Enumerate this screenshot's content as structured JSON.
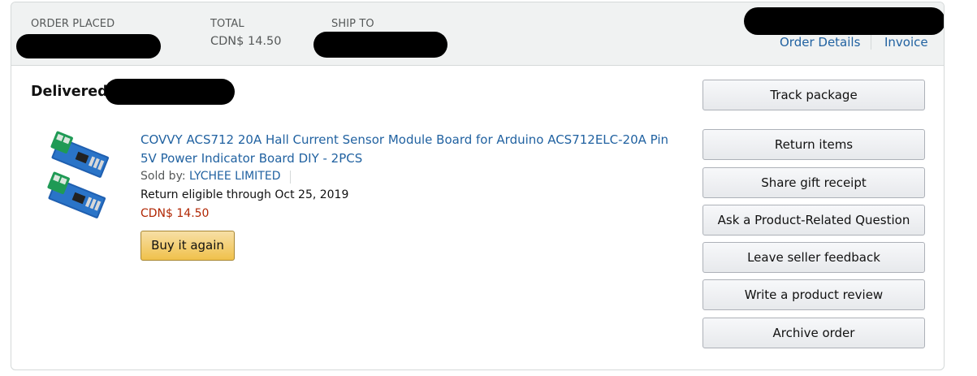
{
  "header": {
    "order_placed_label": "ORDER PLACED",
    "total_label": "TOTAL",
    "total_value": "CDN$ 14.50",
    "ship_to_label": "SHIP TO",
    "order_details_link": "Order Details",
    "invoice_link": "Invoice"
  },
  "status": {
    "title": "Delivered"
  },
  "item": {
    "title": "COVVY ACS712 20A Hall Current Sensor Module Board for Arduino ACS712ELC-20A Pin 5V Power Indicator Board DIY - 2PCS",
    "sold_by_label": "Sold by: ",
    "seller": "LYCHEE LIMITED",
    "return_eligible": "Return eligible through Oct 25, 2019",
    "price": "CDN$ 14.50",
    "buy_again_label": "Buy it again"
  },
  "actions": {
    "track_package": "Track package",
    "return_items": "Return items",
    "share_gift_receipt": "Share gift receipt",
    "ask_question": "Ask a Product-Related Question",
    "leave_feedback": "Leave seller feedback",
    "write_review": "Write a product review",
    "archive_order": "Archive order"
  },
  "colors": {
    "link": "#2162a1",
    "price": "#b12704",
    "header_bg": "#f0f2f2",
    "buy_button": "#f0c14b"
  }
}
